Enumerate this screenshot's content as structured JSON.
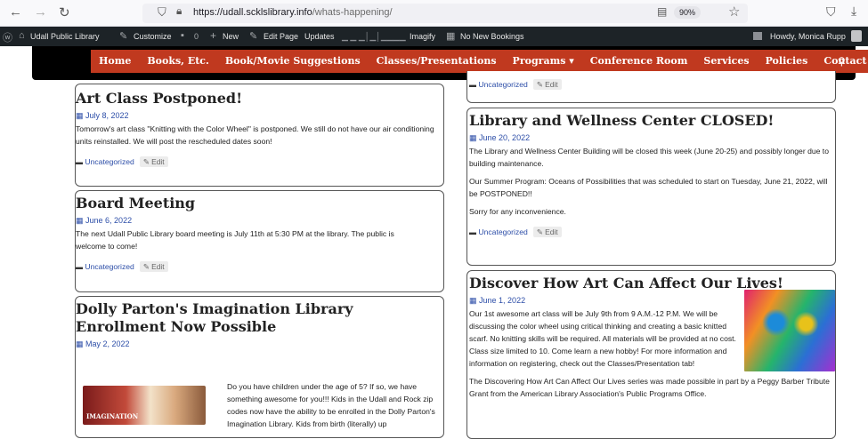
{
  "browser": {
    "url_host": "https://udall.scklslibrary.info",
    "url_path": "/whats-happening/",
    "zoom": "90%"
  },
  "adminbar": {
    "site": "Udall Public Library",
    "customize": "Customize",
    "comments": "0",
    "new": "New",
    "edit_page": "Edit Page",
    "updates": "Updates",
    "imagify": "Imagify",
    "bookings": "No New Bookings",
    "howdy": "Howdy, Monica Rupp"
  },
  "nav": {
    "items": [
      "Home",
      "Books, Etc.",
      "Book/Movie Suggestions",
      "Classes/Presentations",
      "Programs",
      "Conference Room",
      "Services",
      "Policies",
      "Contact Us"
    ]
  },
  "posts": {
    "art": {
      "title": "Art Class Postponed!",
      "date": "July 8, 2022",
      "text": "Tomorrow's art class \"Knitting with the Color Wheel\" is postponed. We still do not have our air conditioning units reinstalled. We will post the rescheduled dates soon!",
      "category": "Uncategorized",
      "edit": "Edit"
    },
    "board": {
      "title": "Board Meeting",
      "date": "June 6, 2022",
      "text": "The next Udall Public Library board meeting is July 11th at 5:30 PM at the library. The public is welcome to come!",
      "category": "Uncategorized",
      "edit": "Edit"
    },
    "dolly": {
      "title": "Dolly Parton's Imagination Library Enrollment Now Possible",
      "date": "May 2, 2022",
      "text": "Do you have children under the age of 5? If so, we have something awesome for you!!! Kids in the Udall and Rock zip codes now have the ability to be enrolled in the Dolly Parton's Imagination Library. Kids from birth (literally) up",
      "image_label": "IMAGINATION"
    },
    "top_right": {
      "category": "Uncategorized",
      "edit": "Edit"
    },
    "closed": {
      "title": "Library and Wellness Center CLOSED!",
      "date": "June 20, 2022",
      "p1": "The Library and Wellness Center Building will be closed this week (June 20-25) and possibly longer due to building maintenance.",
      "p2": "Our Summer Program: Oceans of Possibilities that was scheduled to start on Tuesday, June 21, 2022, will be POSTPONED!!",
      "p3": "Sorry for any inconvenience.",
      "category": "Uncategorized",
      "edit": "Edit"
    },
    "discover": {
      "title": "Discover How Art Can Affect Our Lives!",
      "date": "June 1, 2022",
      "p1": "Our 1st awesome art class will be July 9th from 9 A.M.-12 P.M. We will be discussing the color wheel using critical thinking and creating a basic knitted scarf. No knitting skills will be required. All materials will be provided at no cost. Class size limited to 10. Come learn a new hobby! For more information and information on registering, check out the Classes/Presentation tab!",
      "p2": "The Discovering How Art Can Affect Our Lives series was made possible in part by a Peggy Barber Tribute Grant from the American Library Association's Public Programs Office."
    }
  }
}
